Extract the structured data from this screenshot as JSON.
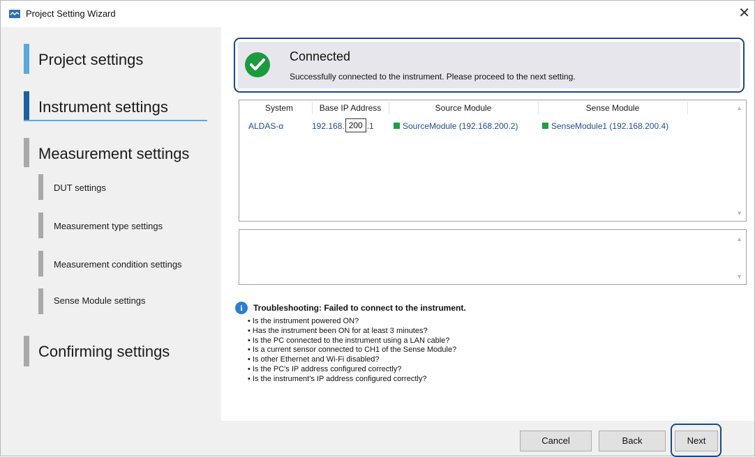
{
  "window": {
    "title": "Project Setting Wizard"
  },
  "sidebar": {
    "steps": [
      {
        "label": "Project settings"
      },
      {
        "label": "Instrument settings"
      },
      {
        "label": "Measurement settings"
      },
      {
        "label": "DUT settings"
      },
      {
        "label": "Measurement type settings"
      },
      {
        "label": "Measurement condition settings"
      },
      {
        "label": "Sense Module settings"
      },
      {
        "label": "Confirming settings"
      }
    ]
  },
  "status": {
    "title": "Connected",
    "message": "Successfully connected to the instrument. Please proceed to the next setting."
  },
  "table": {
    "headers": [
      "System",
      "Base IP Address",
      "Source Module",
      "Sense Module"
    ],
    "row": {
      "system": "ALDAS-α",
      "ip_prefix": "192.168.",
      "ip_value": "200",
      "ip_suffix": ".1",
      "source_module": "SourceModule (192.168.200.2)",
      "sense_module": "SenseModule1 (192.168.200.4)"
    }
  },
  "troubleshooting": {
    "icon": "info-icon",
    "title": "Troubleshooting: Failed to connect to the instrument.",
    "items": [
      "Is the instrument powered ON?",
      "Has the instrument been ON for at least 3 minutes?",
      "Is the PC connected to the instrument using a LAN cable?",
      "Is a current sensor connected to CH1 of the Sense Module?",
      "Is other Ethernet and Wi-Fi disabled?",
      "Is the PC's IP address configured correctly?",
      "Is the instrument's IP address configured correctly?"
    ]
  },
  "buttons": {
    "cancel": "Cancel",
    "back": "Back",
    "next": "Next"
  },
  "colors": {
    "accent_dark": "#1b4a86",
    "accent_light": "#5aa8df",
    "success": "#1b9a3e",
    "module_status": "#1f9e44"
  }
}
